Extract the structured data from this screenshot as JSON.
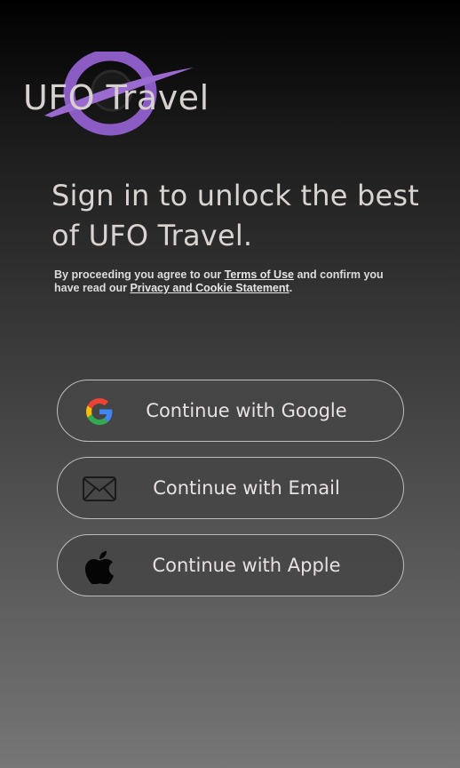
{
  "brand": {
    "name": "UFO Travel",
    "accent_color": "#8a5cc4"
  },
  "signin": {
    "headline_line1": "Sign in to unlock the best",
    "headline_line2": "of UFO Travel."
  },
  "legal": {
    "prefix": "By proceeding you agree to our ",
    "terms_link": "Terms of Use",
    "middle": " and confirm you have read our ",
    "privacy_link": "Privacy and Cookie Statement",
    "suffix": "."
  },
  "buttons": {
    "google": {
      "label": "Continue with Google",
      "icon": "google-icon"
    },
    "email": {
      "label": "Continue with Email",
      "icon": "mail-icon"
    },
    "apple": {
      "label": "Continue with Apple",
      "icon": "apple-icon"
    }
  }
}
